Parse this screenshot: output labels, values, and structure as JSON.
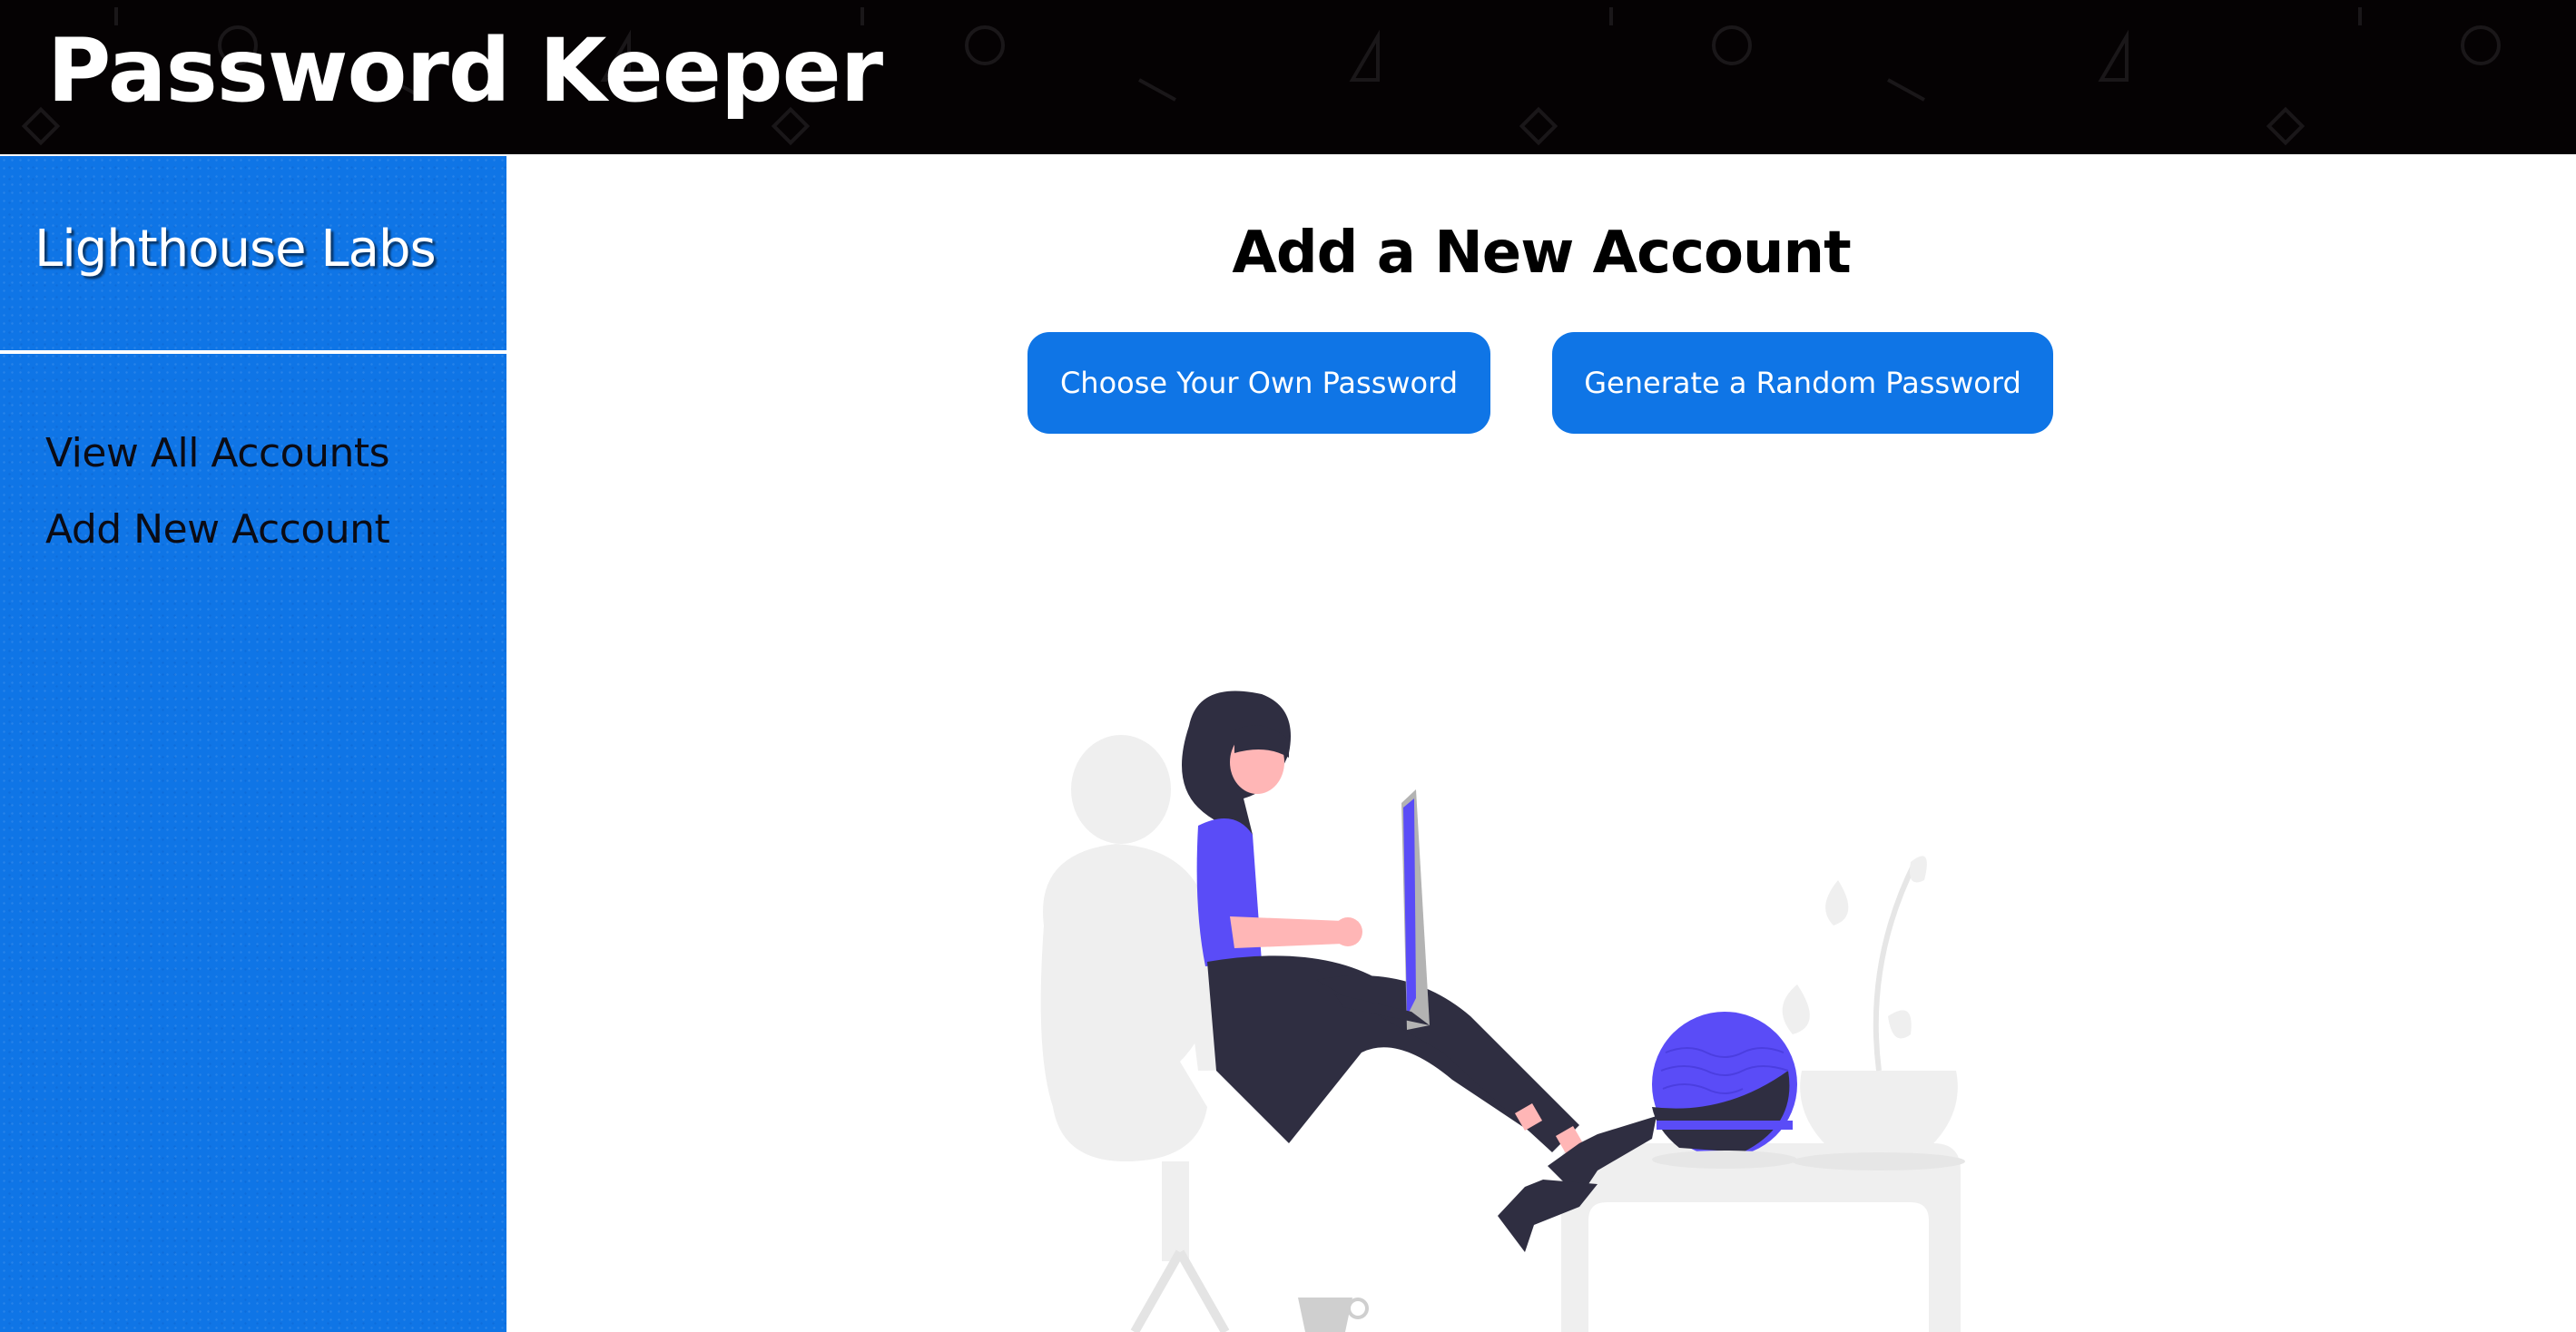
{
  "header": {
    "title": "Password Keeper",
    "background_color": "#050203"
  },
  "sidebar": {
    "brand": "Lighthouse Labs",
    "background_color": "#0f75e6",
    "items": [
      {
        "label": "View All Accounts"
      },
      {
        "label": "Add New Account"
      }
    ]
  },
  "main": {
    "title": "Add a New Account",
    "buttons": {
      "choose_own": "Choose Your Own Password",
      "generate_random": "Generate a Random Password"
    },
    "button_color": "#0f75e6",
    "illustration": "woman-with-laptop-illustration"
  }
}
